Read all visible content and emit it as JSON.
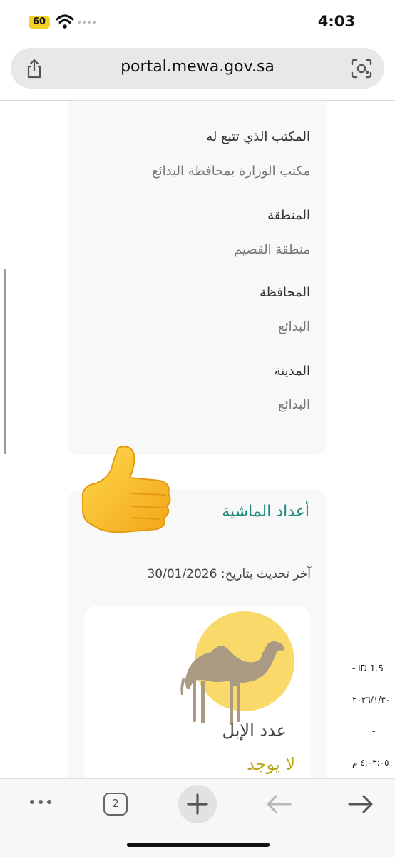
{
  "status_bar": {
    "battery": "60",
    "time": "4:03"
  },
  "browser": {
    "url": "portal.mewa.gov.sa",
    "tab_count": "2"
  },
  "info": {
    "office_label": "المكتب الذي تتبع له",
    "office_value": "مكتب الوزارة بمحافظة البدائع",
    "region_label": "المنطقة",
    "region_value": "منطقة القصيم",
    "governorate_label": "المحافظة",
    "governorate_value": "البدائع",
    "city_label": "المدينة",
    "city_value": "البدائع"
  },
  "livestock": {
    "title": "أعداد الماشية",
    "updated": "آخر تحديث بتاريخ: 30/01/2026",
    "camels_label": "عدد الإبل",
    "camels_value": "لا يوجد"
  },
  "watermark": {
    "id": "- ID 1.5",
    "date": "٢٠٢٦/١/٣٠",
    "dash": "-",
    "time": "٤:٠٣:٠٥ م"
  },
  "icons": [
    "share-icon",
    "lens-icon",
    "wifi-icon",
    "thumbs-up-emoji",
    "camel-icon",
    "more-icon",
    "plus-icon",
    "back-arrow-icon",
    "forward-arrow-icon"
  ],
  "colors": {
    "accent_teal": "#1d8a7c",
    "value_gold": "#b8a81a",
    "sun_yellow": "#f8d96a",
    "battery_yellow": "#f2cf24"
  }
}
